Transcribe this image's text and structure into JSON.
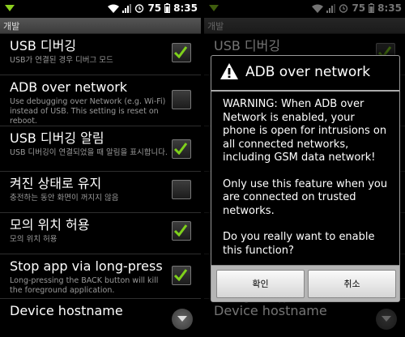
{
  "status": {
    "battery": "75",
    "time": "8:35"
  },
  "title": "개발",
  "settings": [
    {
      "title": "USB 디버깅",
      "summary": "USB가 연결된 경우 디버그 모드",
      "checked": true
    },
    {
      "title": "ADB over network",
      "summary": "Use debugging over Network (e.g. Wi-Fi) instead of USB. This setting is reset on reboot.",
      "checked": false
    },
    {
      "title": "USB 디버깅 알림",
      "summary": "USB 디버깅이 연결되었을 때 알림을 표시합니다.",
      "checked": true
    },
    {
      "title": "켜진 상태로 유지",
      "summary": "충전하는 동안 화면이 꺼지지 않음",
      "checked": false
    },
    {
      "title": "모의 위치 허용",
      "summary": "모의 위치 허용",
      "checked": true
    },
    {
      "title": "Stop app via long-press",
      "summary": "Long-pressing the BACK button will kill the foreground application.",
      "checked": true
    },
    {
      "title": "Device hostname",
      "summary": ""
    }
  ],
  "dialog": {
    "title": "ADB over network",
    "paragraphs": [
      "WARNING: When ADB over Network is enabled, your phone is open for intrusions on all connected networks, including GSM data network!",
      "Only use this feature when you are connected on trusted networks.",
      "Do you really want to enable this function?"
    ],
    "ok_label": "확인",
    "cancel_label": "취소"
  },
  "colors": {
    "checkmark": "#7fd11b",
    "warning": "#ffffff"
  }
}
